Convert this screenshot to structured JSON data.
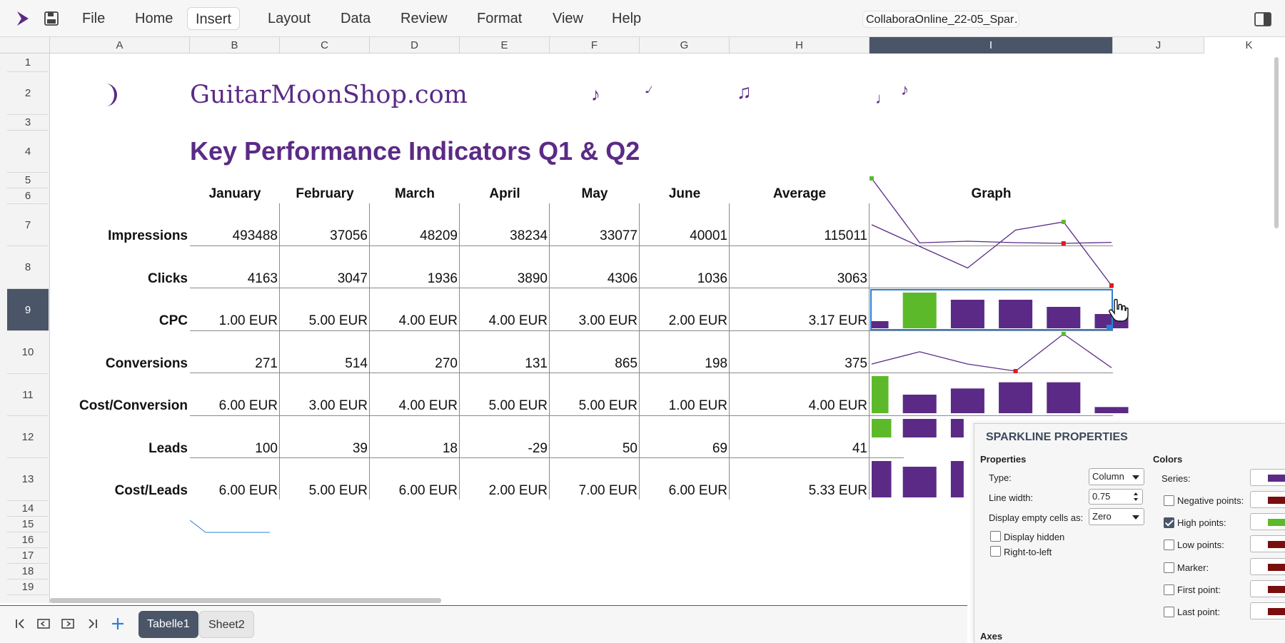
{
  "app": {
    "document_title": "CollaboraOnline_22-05_Spar…",
    "menu": [
      "File",
      "Home",
      "Insert",
      "Layout",
      "Data",
      "Review",
      "Format",
      "View",
      "Help"
    ],
    "active_menu": "Insert"
  },
  "columns": [
    "A",
    "B",
    "C",
    "D",
    "E",
    "F",
    "G",
    "H",
    "I",
    "J",
    "K"
  ],
  "selected_column": "I",
  "rows": [
    "1",
    "2",
    "3",
    "4",
    "5",
    "6",
    "7",
    "8",
    "9",
    "10",
    "11",
    "12",
    "13",
    "14",
    "15",
    "16",
    "17",
    "18",
    "19"
  ],
  "selected_row": "9",
  "sheet": {
    "brand": "GuitarMoonShop.com",
    "title": "Key Performance Indicators Q1 & Q2",
    "headers": [
      "January",
      "February",
      "March",
      "April",
      "May",
      "June",
      "Average",
      "Graph"
    ],
    "data_rows": [
      {
        "label": "Impressions",
        "values": [
          "493488",
          "37056",
          "48209",
          "38234",
          "33077",
          "40001"
        ],
        "average": "115011"
      },
      {
        "label": "Clicks",
        "values": [
          "4163",
          "3047",
          "1936",
          "3890",
          "4306",
          "1036"
        ],
        "average": "3063"
      },
      {
        "label": "CPC",
        "values": [
          "1.00 EUR",
          "5.00 EUR",
          "4.00 EUR",
          "4.00 EUR",
          "3.00 EUR",
          "2.00 EUR"
        ],
        "average": "3.17 EUR"
      },
      {
        "label": "Conversions",
        "values": [
          "271",
          "514",
          "270",
          "131",
          "865",
          "198"
        ],
        "average": "375"
      },
      {
        "label": "Cost/Conversion",
        "values": [
          "6.00 EUR",
          "3.00 EUR",
          "4.00 EUR",
          "5.00 EUR",
          "5.00 EUR",
          "1.00 EUR"
        ],
        "average": "4.00 EUR"
      },
      {
        "label": "Leads",
        "values": [
          "100",
          "39",
          "18",
          "-29",
          "50",
          "69"
        ],
        "average": "41"
      },
      {
        "label": "Cost/Leads",
        "values": [
          "6.00 EUR",
          "5.00 EUR",
          "6.00 EUR",
          "2.00 EUR",
          "7.00 EUR",
          "6.00 EUR"
        ],
        "average": "5.33 EUR"
      }
    ]
  },
  "sparklines": {
    "series_color": "#5b2a86",
    "high_color": "#5cba2a",
    "low_color": "#e01b1b",
    "impressions": {
      "type": "line",
      "values": [
        493488,
        37056,
        48209,
        38234,
        33077,
        40001
      ]
    },
    "clicks": {
      "type": "line",
      "values": [
        4163,
        3047,
        1936,
        3890,
        4306,
        1036
      ]
    },
    "cpc": {
      "type": "column",
      "values": [
        1,
        5,
        4,
        4,
        3,
        2
      ]
    },
    "conversions": {
      "type": "line",
      "values": [
        271,
        514,
        270,
        131,
        865,
        198
      ]
    },
    "cost_conversion": {
      "type": "column",
      "values": [
        6,
        3,
        4,
        5,
        5,
        1
      ]
    }
  },
  "sheet_tabs": [
    "Tabelle1",
    "Sheet2"
  ],
  "active_tab": "Tabelle1",
  "panel": {
    "title": "SPARKLINE PROPERTIES",
    "properties_title": "Properties",
    "type_label": "Type:",
    "type_value": "Column",
    "line_width_label": "Line width:",
    "line_width_value": "0.75",
    "empty_cells_label": "Display empty cells as:",
    "empty_cells_value": "Zero",
    "display_hidden_label": "Display hidden",
    "rtl_label": "Right-to-left",
    "colors_title": "Colors",
    "series_label": "Series:",
    "negative_label": "Negative points:",
    "high_label": "High points:",
    "low_label": "Low points:",
    "marker_label": "Marker:",
    "first_label": "First point:",
    "last_label": "Last point:",
    "axes_title": "Axes",
    "high_checked": true,
    "series_swatch": "#5b2a86",
    "negative_swatch": "#7a0e0e",
    "high_swatch": "#5cba2a",
    "low_swatch": "#7a0e0e",
    "marker_swatch": "#7a0e0e",
    "first_swatch": "#7a0e0e",
    "last_swatch": "#7a0e0e"
  }
}
